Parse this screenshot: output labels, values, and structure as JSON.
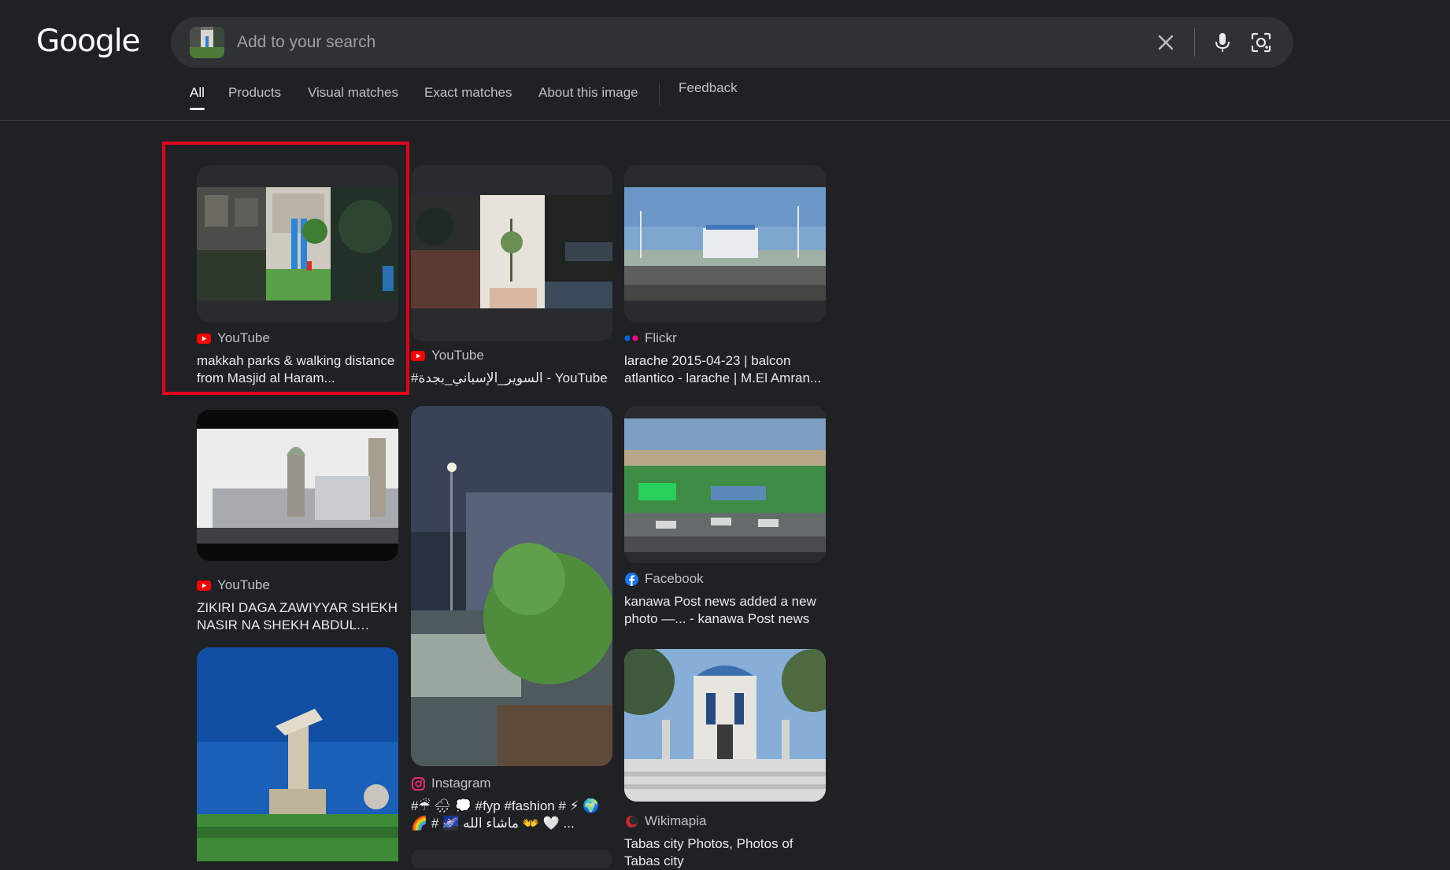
{
  "logo": "Google",
  "search": {
    "placeholder": "Add to your search"
  },
  "tabs": [
    {
      "label": "All",
      "active": true
    },
    {
      "label": "Products",
      "active": false
    },
    {
      "label": "Visual matches",
      "active": false
    },
    {
      "label": "Exact matches",
      "active": false
    },
    {
      "label": "About this image",
      "active": false
    }
  ],
  "feedback": "Feedback",
  "results": [
    {
      "source": "YouTube",
      "source_icon": "youtube-icon",
      "title": "makkah parks & walking distance from Masjid al Haram..."
    },
    {
      "source": "YouTube",
      "source_icon": "youtube-icon",
      "title": "#السوير_الإسباني_بجدة - YouTube"
    },
    {
      "source": "Flickr",
      "source_icon": "flickr-icon",
      "title": "larache 2015-04-23 | balcon atlantico - larache | M.El Amran..."
    },
    {
      "source": "YouTube",
      "source_icon": "youtube-icon",
      "title": "ZIKIRI DAGA ZAWIYYAR SHEKH NASIR NA SHEKH ABDUL KADI..."
    },
    {
      "source": "Instagram",
      "source_icon": "instagram-icon",
      "title": "#☔ 🌧 💭 #fyp #fashion # ⚡ 🌍 🌈 # 🌌 ماشاء الله 👐 🤍 ..."
    },
    {
      "source": "Facebook",
      "source_icon": "facebook-icon",
      "title": "kanawa Post news added a new photo —... - kanawa Post news"
    },
    {
      "source": "Wikimapia",
      "source_icon": "wikimapia-icon",
      "title": "Tabas city Photos, Photos of Tabas city"
    }
  ],
  "colors": {
    "background": "#202124",
    "search_bar": "#303134",
    "highlight": "#e3001b",
    "youtube": "#ff0000",
    "facebook": "#1877f2"
  }
}
